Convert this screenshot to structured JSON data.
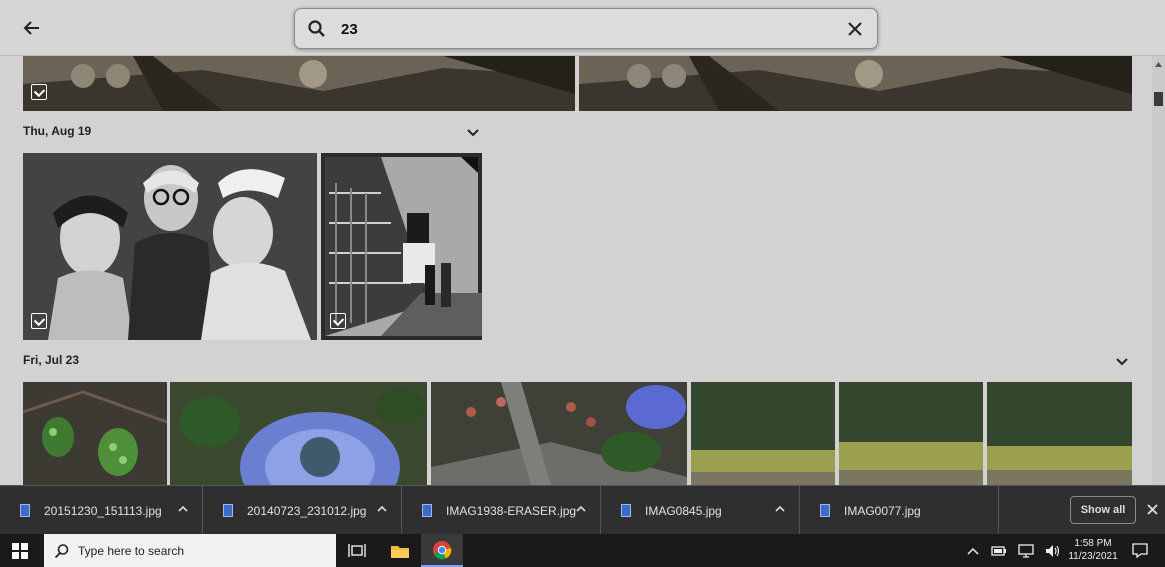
{
  "search": {
    "query": "23"
  },
  "sections": [
    {
      "date": "Thu, Aug 19"
    },
    {
      "date": "Fri, Jul 23"
    }
  ],
  "downloads": [
    {
      "filename": "20151230_151113.jpg"
    },
    {
      "filename": "20140723_231012.jpg"
    },
    {
      "filename": "IMAG1938-ERASER.jpg"
    },
    {
      "filename": "IMAG0845.jpg"
    },
    {
      "filename": "IMAG0077.jpg"
    }
  ],
  "shelf": {
    "show_all_label": "Show all"
  },
  "taskbar": {
    "search_placeholder": "Type here to search",
    "time": "1:58 PM",
    "date": "11/23/2021"
  }
}
